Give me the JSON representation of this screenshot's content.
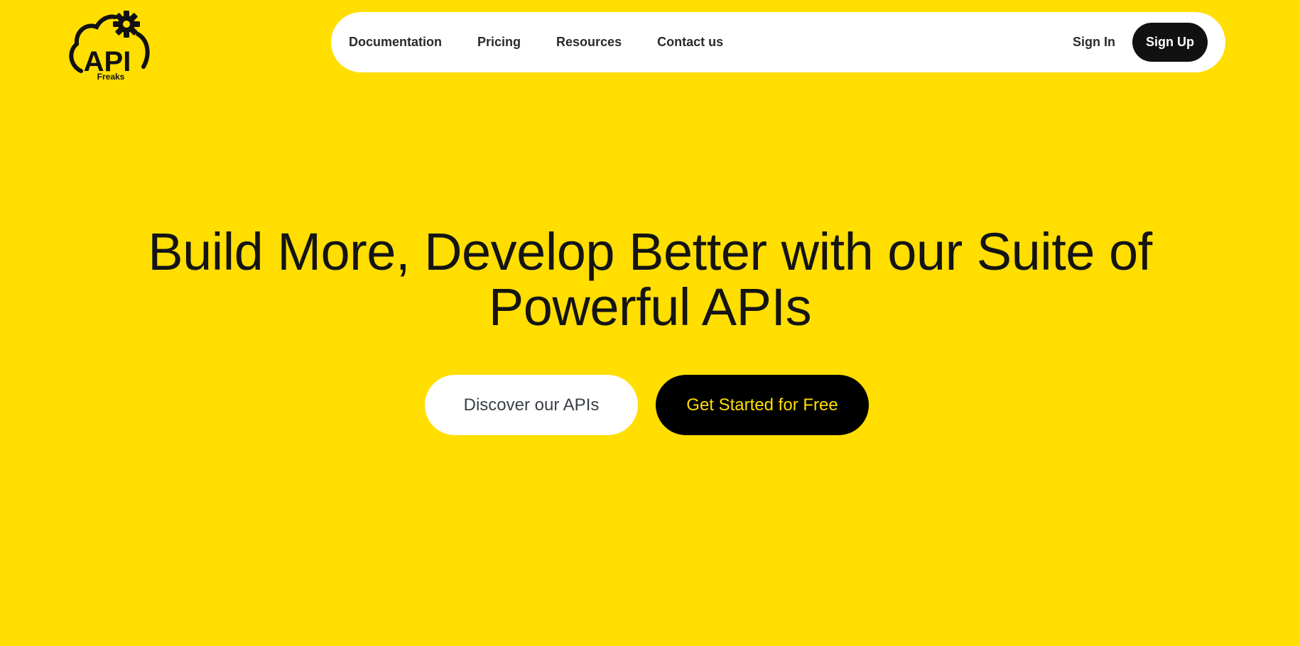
{
  "brand": {
    "logo_text": "API",
    "logo_subtext": "Freaks",
    "logo_icons": [
      "cloud-outline-icon",
      "gear-icon"
    ]
  },
  "nav": {
    "links": [
      "Documentation",
      "Pricing",
      "Resources",
      "Contact us"
    ],
    "sign_in": "Sign In",
    "sign_up": "Sign Up"
  },
  "hero": {
    "title_line1": "Build More, Develop Better with our Suite of",
    "title_line2": "Powerful APIs",
    "cta_secondary": "Discover our APIs",
    "cta_primary": "Get Started for Free"
  },
  "colors": {
    "background": "#FFDE00",
    "nav_background": "#FFFFFF",
    "dark": "#111111",
    "primary_cta_text": "#FFDE00"
  }
}
